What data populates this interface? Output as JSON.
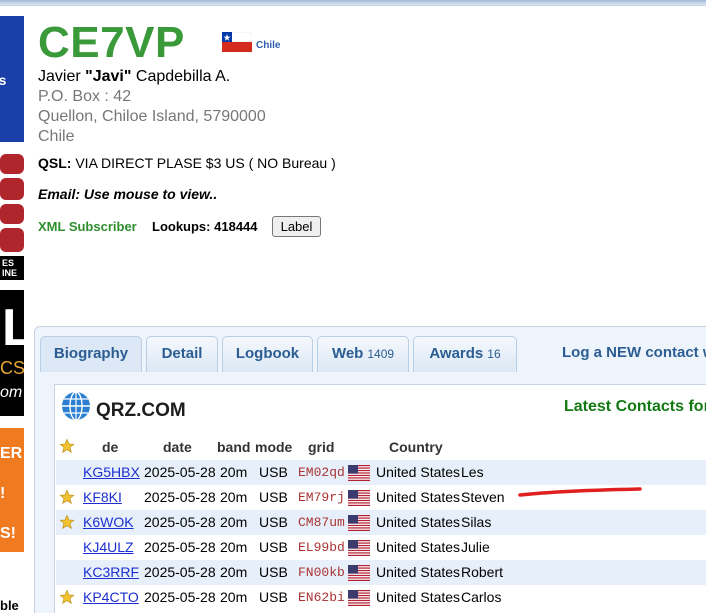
{
  "callsign": "CE7VP",
  "country_link": "Chile",
  "name": {
    "first": "Javier",
    "nick": "\"Javi\"",
    "last": "Capdebilla A."
  },
  "address": [
    "P.O. Box : 42",
    "Quellon, Chiloe Island, 5790000",
    "Chile"
  ],
  "qsl": {
    "label": "QSL:",
    "text": "VIA DIRECT PLASE $3 US ( NO Bureau )"
  },
  "email_text": "Email: Use mouse to view..",
  "xml_subscriber": "XML Subscriber",
  "lookups": {
    "label": "Lookups:",
    "value": "418444"
  },
  "label_button": "Label",
  "tabs": [
    {
      "label": "Biography",
      "count": ""
    },
    {
      "label": "Detail",
      "count": ""
    },
    {
      "label": "Logbook",
      "count": ""
    },
    {
      "label": "Web",
      "count": "1409"
    },
    {
      "label": "Awards",
      "count": "16"
    }
  ],
  "log_new_contact": "Log a NEW contact w",
  "qrz_logo": "QRZ.COM",
  "latest_contacts_title": "Latest Contacts for",
  "table": {
    "headers": [
      "de",
      "date",
      "band",
      "mode",
      "grid",
      "Country"
    ],
    "rows": [
      {
        "star": false,
        "call": "KG5HBX",
        "date": "2025-05-28",
        "band": "20m",
        "mode": "USB",
        "grid": "EM02qd",
        "country": "United States",
        "name": "Les"
      },
      {
        "star": true,
        "call": "KF8KI",
        "date": "2025-05-28",
        "band": "20m",
        "mode": "USB",
        "grid": "EM79rj",
        "country": "United States",
        "name": "Steven"
      },
      {
        "star": true,
        "call": "K6WOK",
        "date": "2025-05-28",
        "band": "20m",
        "mode": "USB",
        "grid": "CM87um",
        "country": "United States",
        "name": "Silas"
      },
      {
        "star": false,
        "call": "KJ4ULZ",
        "date": "2025-05-28",
        "band": "20m",
        "mode": "USB",
        "grid": "EL99bd",
        "country": "United States",
        "name": "Julie"
      },
      {
        "star": false,
        "call": "KC3RRF",
        "date": "2025-05-28",
        "band": "20m",
        "mode": "USB",
        "grid": "FN00kb",
        "country": "United States",
        "name": "Robert"
      },
      {
        "star": true,
        "call": "KP4CTO",
        "date": "2025-05-28",
        "band": "20m",
        "mode": "USB",
        "grid": "EN62bi",
        "country": "United States",
        "name": "Carlos"
      }
    ]
  },
  "ads": {
    "ad1_text": "ts",
    "ad2_text": "ES\nINE",
    "ad3_big": "L",
    "ad3_mid": "CS",
    "ad3_small": "om",
    "ad4_text": "ER\n!\nS!",
    "ad5_text": "ble"
  },
  "colors": {
    "callsign_green": "#3a9a3a",
    "link_blue": "#1c2fd1",
    "tab_text": "#2b5d92",
    "grid_red": "#aa3333",
    "row_alt": "#e7f0fa",
    "annotation_red": "#e02020"
  }
}
